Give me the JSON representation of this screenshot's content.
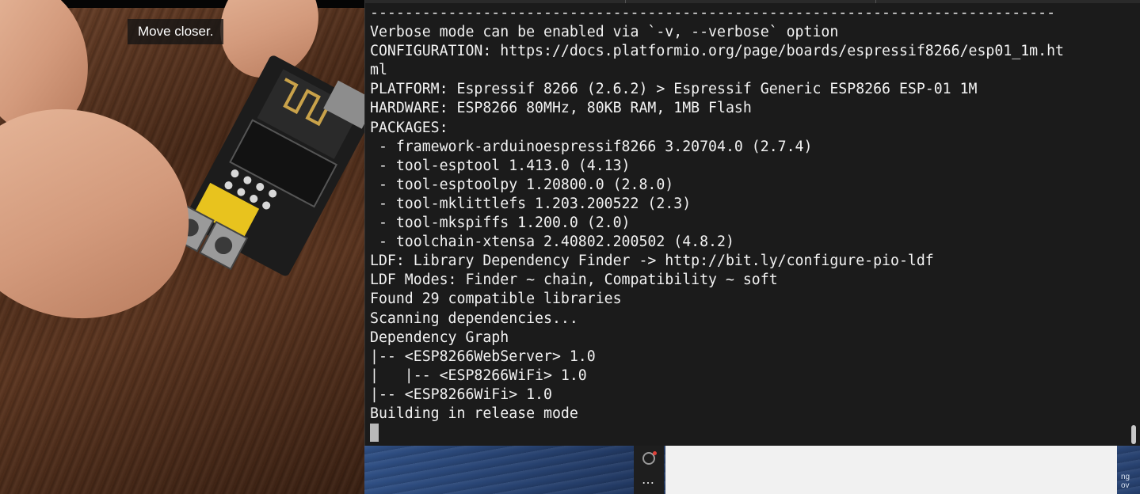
{
  "camera": {
    "caption": "Move closer."
  },
  "terminal": {
    "lines": [
      "-------------------------------------------------------------------------------",
      "Verbose mode can be enabled via `-v, --verbose` option",
      "CONFIGURATION: https://docs.platformio.org/page/boards/espressif8266/esp01_1m.ht",
      "ml",
      "PLATFORM: Espressif 8266 (2.6.2) > Espressif Generic ESP8266 ESP-01 1M",
      "HARDWARE: ESP8266 80MHz, 80KB RAM, 1MB Flash",
      "PACKAGES:",
      " - framework-arduinoespressif8266 3.20704.0 (2.7.4)",
      " - tool-esptool 1.413.0 (4.13)",
      " - tool-esptoolpy 1.20800.0 (2.8.0)",
      " - tool-mklittlefs 1.203.200522 (2.3)",
      " - tool-mkspiffs 1.200.0 (2.0)",
      " - toolchain-xtensa 2.40802.200502 (4.8.2)",
      "LDF: Library Dependency Finder -> http://bit.ly/configure-pio-ldf",
      "LDF Modes: Finder ~ chain, Compatibility ~ soft",
      "Found 29 compatible libraries",
      "Scanning dependencies...",
      "Dependency Graph",
      "|-- <ESP8266WebServer> 1.0",
      "|   |-- <ESP8266WiFi> 1.0",
      "|-- <ESP8266WiFi> 1.0",
      "Building in release mode"
    ]
  },
  "dock": {
    "record_icon": "record-icon",
    "more_label": "…"
  },
  "desktop": {
    "edge_text": "ng\nov"
  },
  "colors": {
    "terminal_bg": "#1b1b1b",
    "terminal_fg": "#f2f2f2",
    "record_dot": "#e0413a"
  }
}
